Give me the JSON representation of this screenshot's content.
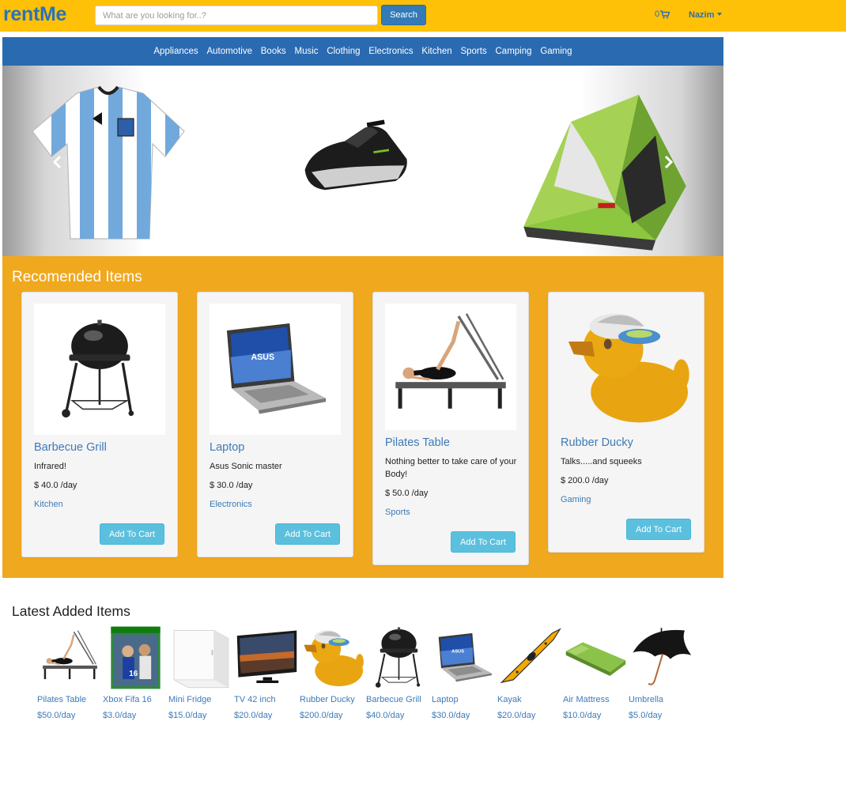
{
  "header": {
    "brand": "rentMe",
    "search_placeholder": "What are you looking for..?",
    "search_button": "Search",
    "cart_count": "0",
    "user_name": "Nazim"
  },
  "categories": [
    "Appliances",
    "Automotive",
    "Books",
    "Music",
    "Clothing",
    "Electronics",
    "Kitchen",
    "Sports",
    "Camping",
    "Gaming"
  ],
  "carousel": {
    "slides": [
      "football-jersey-image",
      "jet-ski-image",
      "camping-tent-image"
    ]
  },
  "recommended": {
    "title": "Recomended Items",
    "add_to_cart_label": "Add To Cart",
    "items": [
      {
        "name": "Barbecue Grill",
        "description": "Infrared!",
        "price": "$ 40.0 /day",
        "category": "Kitchen"
      },
      {
        "name": "Laptop",
        "description": "Asus Sonic master",
        "price": "$ 30.0 /day",
        "category": "Electronics"
      },
      {
        "name": "Pilates Table",
        "description": "Nothing better to take care of your Body!",
        "price": "$ 50.0 /day",
        "category": "Sports"
      },
      {
        "name": "Rubber Ducky",
        "description": "Talks.....and squeeks",
        "price": "$ 200.0 /day",
        "category": "Gaming"
      }
    ]
  },
  "latest": {
    "title": "Latest Added Items",
    "items": [
      {
        "name": "Pilates Table",
        "price": "$50.0/day"
      },
      {
        "name": "Xbox Fifa 16",
        "price": "$3.0/day"
      },
      {
        "name": "Mini Fridge",
        "price": "$15.0/day"
      },
      {
        "name": "TV 42 inch",
        "price": "$20.0/day"
      },
      {
        "name": "Rubber Ducky",
        "price": "$200.0/day"
      },
      {
        "name": "Barbecue Grill",
        "price": "$40.0/day"
      },
      {
        "name": "Laptop",
        "price": "$30.0/day"
      },
      {
        "name": "Kayak",
        "price": "$20.0/day"
      },
      {
        "name": "Air Mattress",
        "price": "$10.0/day"
      },
      {
        "name": "Umbrella",
        "price": "$5.0/day"
      }
    ]
  },
  "colors": {
    "topbar": "#FFC107",
    "brand": "#2a73b8",
    "nav": "#2a6ab0",
    "recommended_bg": "#F0A81E",
    "add_button": "#5bc0de",
    "link": "#3d7ab8"
  }
}
